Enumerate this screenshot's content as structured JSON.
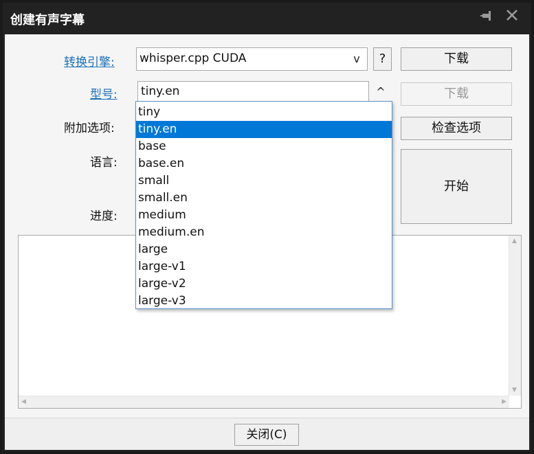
{
  "window": {
    "title": "创建有声字幕",
    "pin_icon": "pin-icon",
    "close_icon": "close-icon"
  },
  "form": {
    "engine_label": "转换引擎:",
    "engine_value": "whisper.cpp CUDA",
    "engine_arrow": "v",
    "help_label": "?",
    "download_label": "下载",
    "model_label": "型号:",
    "model_value": "tiny.en",
    "model_arrow": "^",
    "download2_label": "下载",
    "options_label": "附加选项:",
    "check_options_label": "检查选项",
    "language_label": "语言:",
    "start_label": "开始",
    "progress_label": "进度:"
  },
  "model_options": [
    "tiny",
    "tiny.en",
    "base",
    "base.en",
    "small",
    "small.en",
    "medium",
    "medium.en",
    "large",
    "large-v1",
    "large-v2",
    "large-v3"
  ],
  "selected_option_index": 1,
  "footer": {
    "close_label": "关闭(C)"
  },
  "colors": {
    "selection": "#0078d7",
    "link": "#1a6fb8"
  }
}
